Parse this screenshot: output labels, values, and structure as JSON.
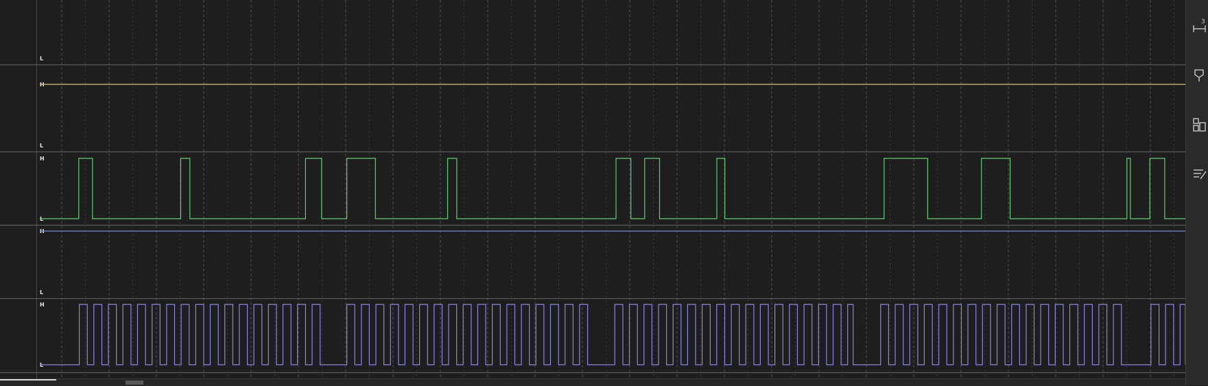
{
  "level_labels": {
    "high": "H",
    "low": "L"
  },
  "channels": [
    {
      "name": "",
      "color": "#d9c97a",
      "high": false,
      "low": true,
      "constant": null,
      "edges": []
    },
    {
      "name": "",
      "color": "#d9c97a",
      "high": true,
      "low": true,
      "constant": "high",
      "edges": []
    },
    {
      "name": "",
      "color": "#5fd36f",
      "high": true,
      "low": true,
      "constant": null,
      "start": 0,
      "edges": [
        0.034,
        0.046,
        0.123,
        0.131,
        0.232,
        0.246,
        0.268,
        0.293,
        0.356,
        0.364,
        0.503,
        0.516,
        0.528,
        0.541,
        0.591,
        0.598,
        0.737,
        0.775,
        0.822,
        0.847,
        0.949,
        0.952,
        0.969,
        0.982
      ]
    },
    {
      "name": "",
      "color": "#6f8fd6",
      "high": true,
      "low": true,
      "constant": "high",
      "edges": []
    },
    {
      "name": "",
      "color": "#8a86e6",
      "high": true,
      "low": true,
      "constant": null,
      "start": 0,
      "clock_period": 0.0127,
      "bursts": [
        [
          0.0345,
          0.247
        ],
        [
          0.268,
          0.479
        ],
        [
          0.502,
          0.71
        ],
        [
          0.734,
          0.946
        ],
        [
          0.97,
          1.0
        ]
      ]
    }
  ],
  "toolbar": {
    "measure_number": "3",
    "tools": [
      {
        "id": "measure",
        "icon": "ruler-icon"
      },
      {
        "id": "marker",
        "icon": "marker-flag-icon"
      },
      {
        "id": "layout",
        "icon": "layout-grid-icon"
      },
      {
        "id": "annotate",
        "icon": "annotate-lines-icon"
      }
    ]
  }
}
